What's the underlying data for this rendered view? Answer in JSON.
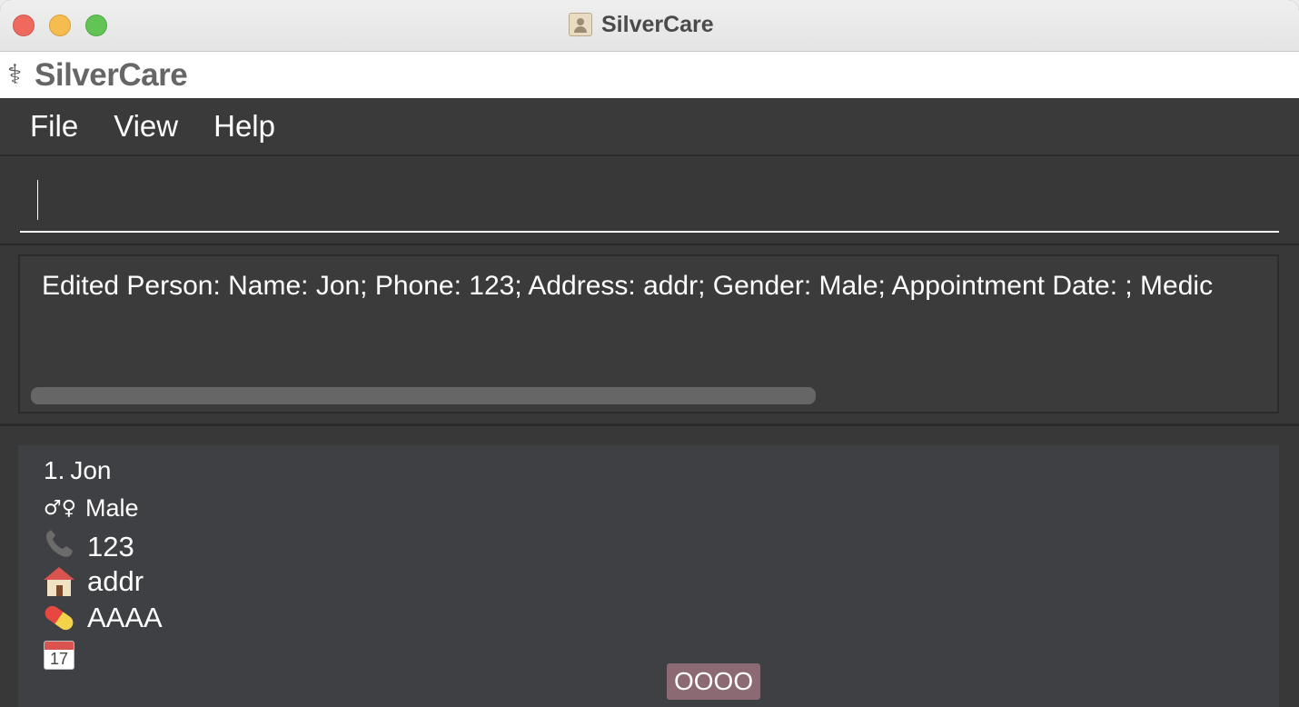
{
  "window": {
    "title": "SilverCare"
  },
  "brand": {
    "icon": "⚕",
    "name": "SilverCare"
  },
  "menu": {
    "items": [
      {
        "label": "File"
      },
      {
        "label": "View"
      },
      {
        "label": "Help"
      }
    ]
  },
  "command": {
    "value": ""
  },
  "result": {
    "text": "Edited Person: Name: Jon; Phone: 123; Address: addr; Gender: Male; Appointment Date: ; Medic"
  },
  "persons": [
    {
      "index": "1.",
      "name": "Jon",
      "gender_icon": "♂♀",
      "gender": "Male",
      "phone_icon": "phone-icon",
      "phone": "123",
      "address_icon": "house-icon",
      "address": "addr",
      "medicine_icon": "pill-icon",
      "medicine": "AAAA",
      "calendar_icon": "calendar-icon",
      "calendar_day": "17",
      "appointment": "",
      "tag": "OOOO"
    }
  ],
  "colors": {
    "background": "#3b3b3b",
    "card": "#3f4044",
    "tag": "#8c6a73"
  }
}
